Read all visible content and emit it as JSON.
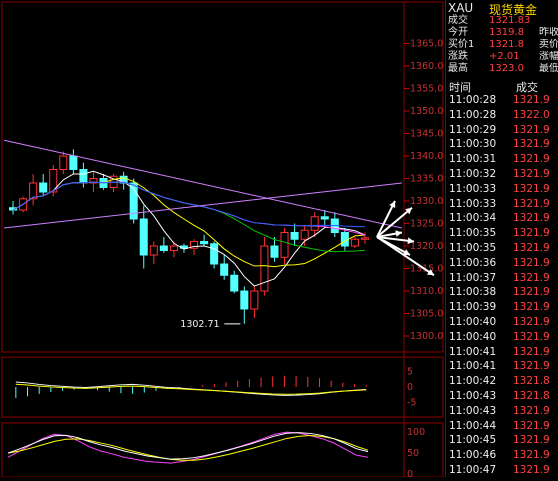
{
  "quote": {
    "symbol": "XAU",
    "name": "现货黄金",
    "rows": [
      {
        "label": "成交",
        "value": "1321.83",
        "label2": ""
      },
      {
        "label": "今开",
        "value": "1319.8",
        "label2": "昨收"
      },
      {
        "label": "买价1",
        "value": "1321.8",
        "label2": "卖价"
      },
      {
        "label": "涨跌",
        "value": "+2.01",
        "label2": "涨幅"
      },
      {
        "label": "最高",
        "value": "1323.0",
        "label2": "最低"
      }
    ]
  },
  "trades": {
    "header_time": "时间",
    "header_price": "成交",
    "rows": [
      {
        "time": "11:00:28",
        "price": "1321.9"
      },
      {
        "time": "11:00:28",
        "price": "1322.0"
      },
      {
        "time": "11:00:29",
        "price": "1321.9"
      },
      {
        "time": "11:00:30",
        "price": "1321.9"
      },
      {
        "time": "11:00:31",
        "price": "1321.9"
      },
      {
        "time": "11:00:32",
        "price": "1321.9"
      },
      {
        "time": "11:00:33",
        "price": "1321.9"
      },
      {
        "time": "11:00:33",
        "price": "1321.9"
      },
      {
        "time": "11:00:34",
        "price": "1321.9"
      },
      {
        "time": "11:00:35",
        "price": "1321.9"
      },
      {
        "time": "11:00:35",
        "price": "1321.9"
      },
      {
        "time": "11:00:36",
        "price": "1321.9"
      },
      {
        "time": "11:00:37",
        "price": "1321.9"
      },
      {
        "time": "11:00:38",
        "price": "1321.9"
      },
      {
        "time": "11:00:39",
        "price": "1321.9"
      },
      {
        "time": "11:00:40",
        "price": "1321.9"
      },
      {
        "time": "11:00:40",
        "price": "1321.9"
      },
      {
        "time": "11:00:41",
        "price": "1321.9"
      },
      {
        "time": "11:00:41",
        "price": "1321.9"
      },
      {
        "time": "11:00:42",
        "price": "1321.8"
      },
      {
        "time": "11:00:43",
        "price": "1321.8"
      },
      {
        "time": "11:00:43",
        "price": "1321.9"
      },
      {
        "time": "11:00:44",
        "price": "1321.9"
      },
      {
        "time": "11:00:45",
        "price": "1321.9"
      },
      {
        "time": "11:00:46",
        "price": "1321.9"
      },
      {
        "time": "11:00:47",
        "price": "1321.9"
      }
    ]
  },
  "chart_data": {
    "type": "candlestick",
    "y_ticks": [
      "1365.0",
      "1360.0",
      "1355.0",
      "1350.0",
      "1345.0",
      "1340.0",
      "1335.0",
      "1330.0",
      "1325.0",
      "1320.0",
      "1315.0",
      "1310.0",
      "1305.0",
      "1300.0"
    ],
    "ylim": [
      1298,
      1368
    ],
    "low_annotation": "1302.71",
    "candles": [
      [
        1328.5,
        1330.0,
        1327.0,
        1328.0
      ],
      [
        1328.0,
        1331.0,
        1327.5,
        1330.5
      ],
      [
        1330.5,
        1336.0,
        1329.0,
        1334.0
      ],
      [
        1334.0,
        1336.0,
        1331.0,
        1332.0
      ],
      [
        1332.0,
        1338.0,
        1331.0,
        1337.0
      ],
      [
        1337.0,
        1341.0,
        1336.0,
        1340.0
      ],
      [
        1340.0,
        1341.5,
        1336.0,
        1337.0
      ],
      [
        1337.0,
        1338.5,
        1333.0,
        1334.0
      ],
      [
        1334.0,
        1336.5,
        1332.0,
        1335.0
      ],
      [
        1335.0,
        1336.0,
        1332.5,
        1333.0
      ],
      [
        1333.0,
        1336.0,
        1332.0,
        1335.5
      ],
      [
        1335.5,
        1336.5,
        1332.5,
        1334.0
      ],
      [
        1334.0,
        1335.0,
        1325.0,
        1326.0
      ],
      [
        1326.0,
        1329.0,
        1315.0,
        1318.0
      ],
      [
        1318.0,
        1321.0,
        1316.0,
        1320.0
      ],
      [
        1320.0,
        1322.0,
        1318.5,
        1319.0
      ],
      [
        1319.0,
        1321.0,
        1317.5,
        1320.0
      ],
      [
        1320.0,
        1320.5,
        1318.5,
        1319.5
      ],
      [
        1319.5,
        1321.5,
        1318.0,
        1321.0
      ],
      [
        1321.0,
        1322.5,
        1320.0,
        1320.5
      ],
      [
        1320.5,
        1321.0,
        1315.0,
        1316.0
      ],
      [
        1316.0,
        1318.0,
        1312.5,
        1313.5
      ],
      [
        1313.5,
        1314.5,
        1309.5,
        1310.0
      ],
      [
        1310.0,
        1311.0,
        1302.7,
        1306.0
      ],
      [
        1306.0,
        1311.0,
        1304.0,
        1310.0
      ],
      [
        1310.0,
        1322.0,
        1309.0,
        1320.0
      ],
      [
        1320.0,
        1322.0,
        1316.5,
        1317.5
      ],
      [
        1317.5,
        1324.0,
        1316.0,
        1323.0
      ],
      [
        1323.0,
        1325.0,
        1320.0,
        1321.5
      ],
      [
        1321.5,
        1324.5,
        1320.0,
        1323.5
      ],
      [
        1323.5,
        1327.5,
        1322.0,
        1326.5
      ],
      [
        1326.5,
        1328.0,
        1324.5,
        1326.0
      ],
      [
        1326.0,
        1327.5,
        1322.0,
        1323.0
      ],
      [
        1323.0,
        1324.0,
        1319.0,
        1320.0
      ],
      [
        1320.0,
        1322.0,
        1319.5,
        1321.5
      ],
      [
        1321.5,
        1323.0,
        1320.5,
        1321.8
      ]
    ],
    "macd_ticks": [
      "5",
      "0",
      "-5"
    ],
    "macd_ylim": [
      -8,
      8
    ],
    "macd_hist": [
      -3.5,
      -3.0,
      -2.2,
      -1.6,
      -1.2,
      -0.8,
      -0.6,
      -1.0,
      -1.5,
      -2.0,
      -2.2,
      -1.8,
      -1.2,
      -0.6,
      -0.3,
      0.2,
      0.6,
      1.0,
      1.5,
      2.0,
      2.5,
      3.0,
      3.4,
      3.6,
      3.5,
      3.2,
      2.8,
      2.0,
      1.4,
      0.9,
      0.5
    ],
    "kdj_ticks": [
      "100",
      "50",
      "0"
    ],
    "kdj_ylim": [
      0,
      110
    ]
  }
}
